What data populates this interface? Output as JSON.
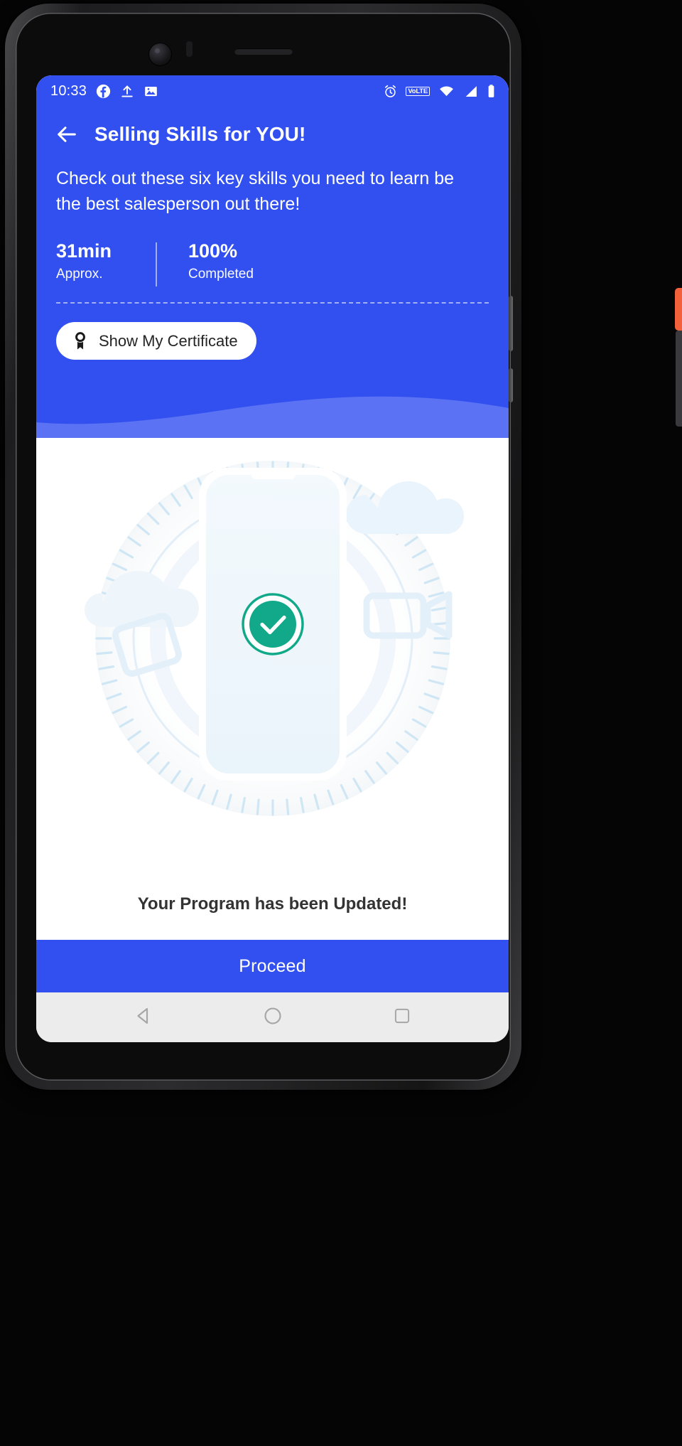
{
  "statusbar": {
    "time": "10:33",
    "left_icons": [
      "facebook-icon",
      "upload-icon",
      "image-icon"
    ],
    "right_icons": [
      "alarm-icon",
      "volte-icon",
      "wifi-icon",
      "signal-icon",
      "battery-icon"
    ],
    "volte_label": "VoLTE"
  },
  "header": {
    "back_label": "Back",
    "title": "Selling Skills for YOU!",
    "description": "Check out these six key skills you need to learn be the best salesperson out there!",
    "background_color": "#3250ef"
  },
  "stats": [
    {
      "value": "31min",
      "label": "Approx."
    },
    {
      "value": "100%",
      "label": "Completed"
    }
  ],
  "certificate_button": {
    "label": "Show My Certificate",
    "icon": "award-medal-icon"
  },
  "illustration": {
    "name": "phone-success-illustration",
    "check_color": "#12a98a",
    "check_icon": "check-icon"
  },
  "status_message": "Your Program has been Updated!",
  "proceed_button": {
    "label": "Proceed"
  },
  "navbar": {
    "back": "back-triangle-icon",
    "home": "home-circle-icon",
    "recents": "recents-square-icon"
  }
}
